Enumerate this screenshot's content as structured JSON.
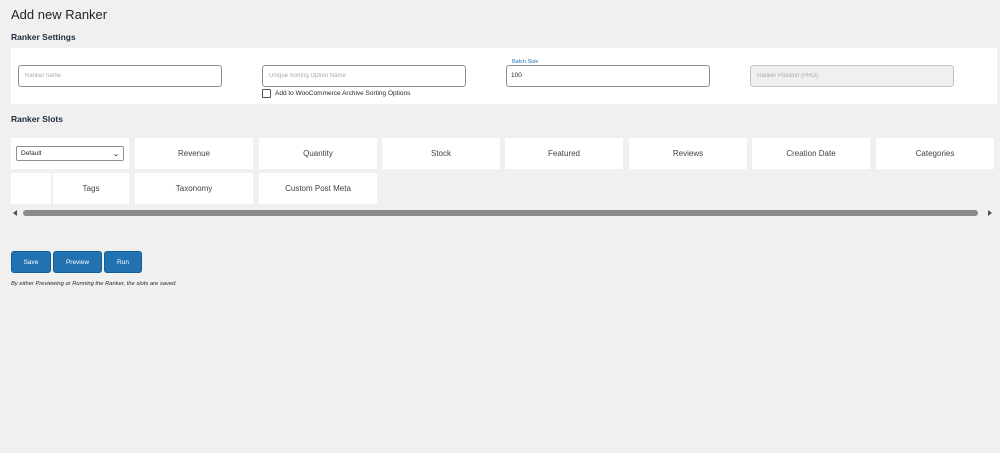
{
  "page": {
    "title": "Add new Ranker"
  },
  "settings": {
    "heading": "Ranker Settings",
    "name_placeholder": "Ranker name",
    "sorting_placeholder": "Unique Sorting Option Name",
    "batch_label": "Batch Size",
    "batch_value": "100",
    "extra_placeholder": "Ranker Position (PRO)",
    "checkbox_label": "Add to WooCommerce Archive Sorting Options",
    "checkbox_checked": false
  },
  "slots": {
    "heading": "Ranker Slots",
    "select_value": "Default",
    "row1": [
      "Revenue",
      "Quantity",
      "Stock",
      "Featured",
      "Reviews",
      "Creation Date",
      "Categories"
    ],
    "row2": [
      "Tags",
      "Taxonomy",
      "Custom Post Meta"
    ]
  },
  "actions": {
    "save": "Save",
    "preview": "Preview",
    "run": "Run"
  },
  "note": "By either Previewing or Running the Ranker, the slots are saved.",
  "colors": {
    "accent": "#2271b1",
    "background": "#f0f0f1"
  }
}
